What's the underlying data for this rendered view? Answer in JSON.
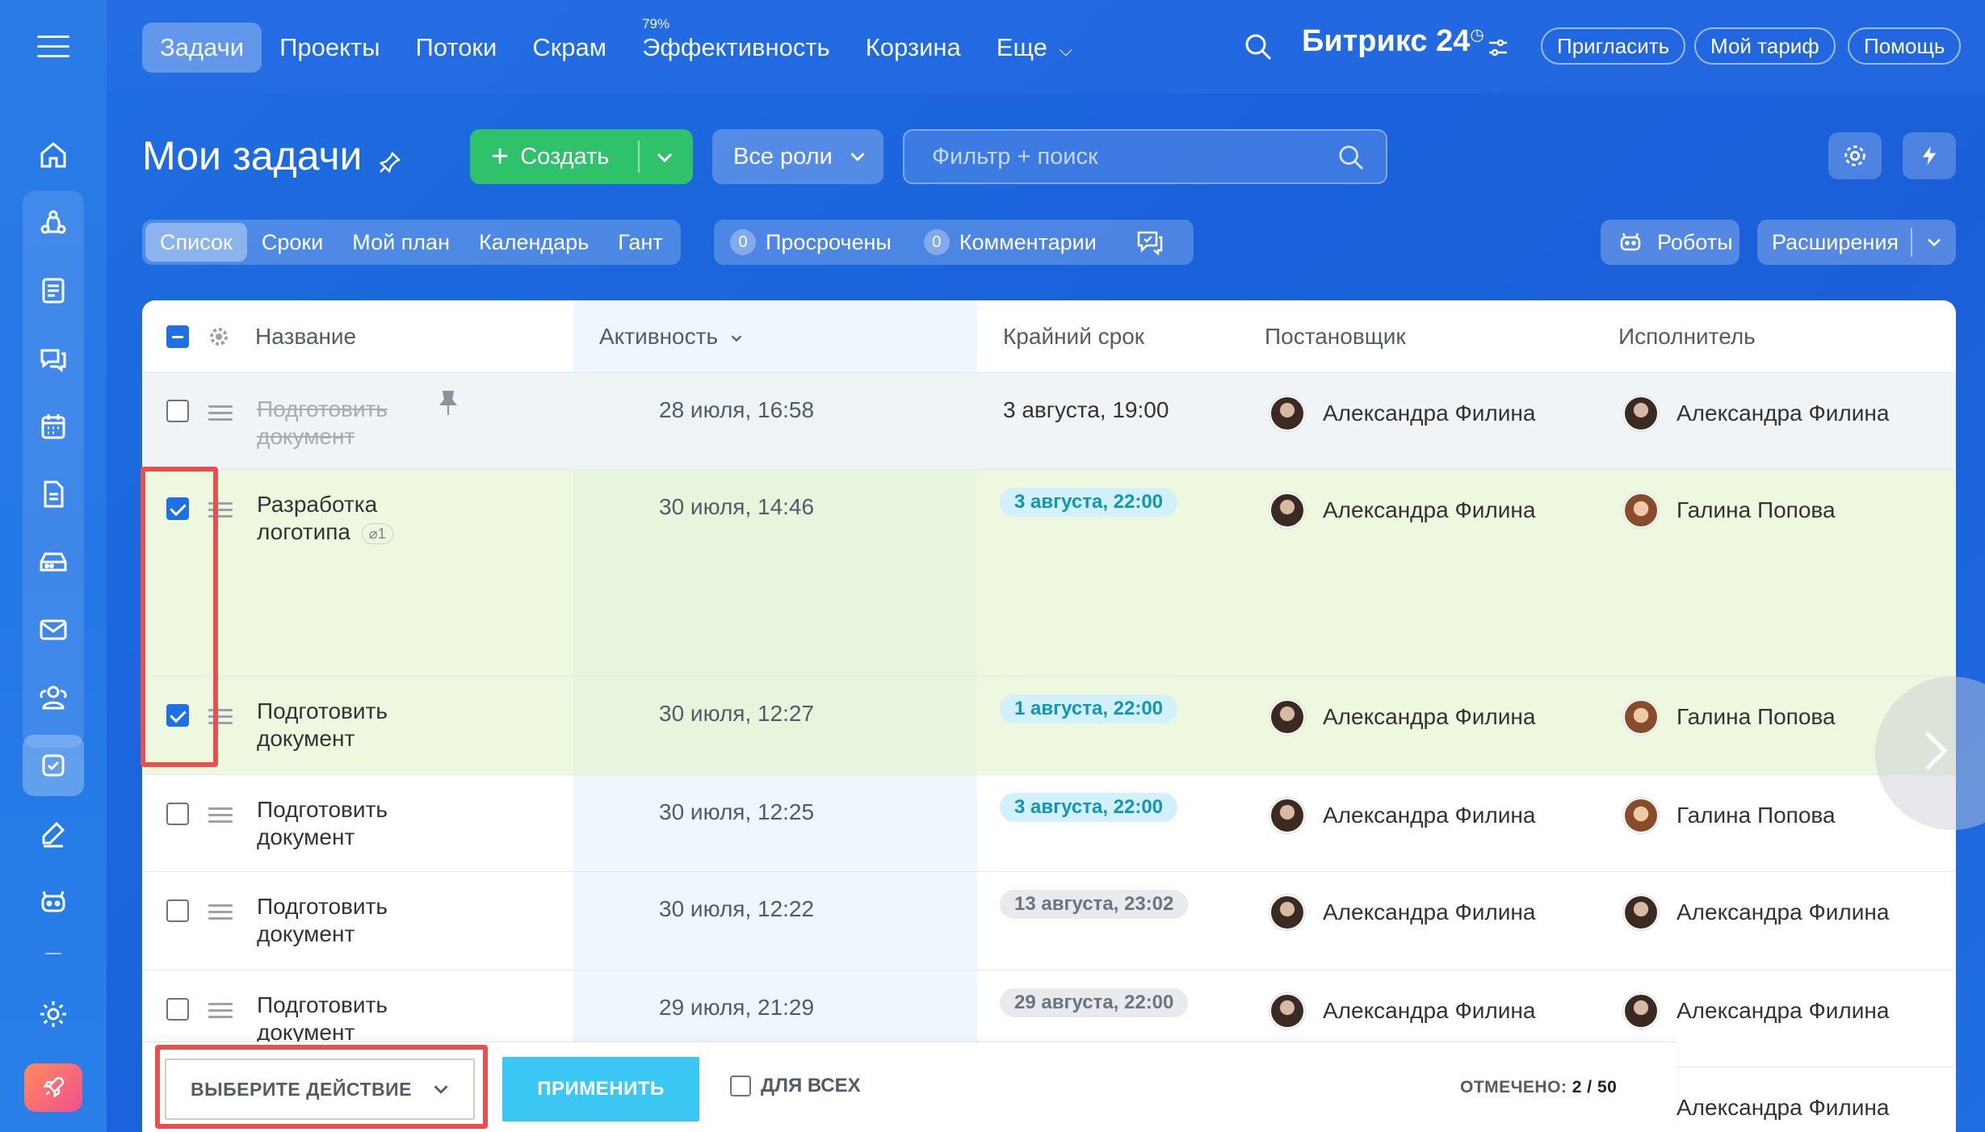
{
  "nav": {
    "items": [
      "Задачи",
      "Проекты",
      "Потоки",
      "Скрам",
      "Эффективность",
      "Корзина",
      "Еще"
    ],
    "efficiency_badge": "79%",
    "more_chevron": "⌵"
  },
  "brand": {
    "name": "Битрикс 24"
  },
  "top_buttons": {
    "invite": "Пригласить",
    "tariff": "Мой тариф",
    "help": "Помощь"
  },
  "header": {
    "title": "Мои задачи",
    "create": "Создать",
    "roles": "Все роли",
    "filter_placeholder": "Фильтр + поиск"
  },
  "views": [
    "Список",
    "Сроки",
    "Мой план",
    "Календарь",
    "Гант"
  ],
  "counters": {
    "overdue_count": "0",
    "overdue_label": "Просрочены",
    "comments_count": "0",
    "comments_label": "Комментарии"
  },
  "right_buttons": {
    "robots": "Роботы",
    "extensions": "Расширения"
  },
  "table": {
    "columns": {
      "name": "Название",
      "activity": "Активность",
      "deadline": "Крайний срок",
      "creator": "Постановщик",
      "assignee": "Исполнитель"
    },
    "rows": [
      {
        "name": "Подготовить документ",
        "activity": "28 июля, 16:58",
        "deadline": "3 августа, 19:00",
        "creator": "Александра Филина",
        "assignee": "Александра Филина"
      },
      {
        "name": "Разработка логотипа",
        "attachments": "1",
        "activity": "30 июля, 14:46",
        "deadline": "3 августа, 22:00",
        "creator": "Александра Филина",
        "assignee": "Галина Попова"
      },
      {
        "name": "Подготовить документ",
        "activity": "30 июля, 12:27",
        "deadline": "1 августа, 22:00",
        "creator": "Александра Филина",
        "assignee": "Галина Попова"
      },
      {
        "name": "Подготовить документ",
        "activity": "30 июля, 12:25",
        "deadline": "3 августа, 22:00",
        "creator": "Александра Филина",
        "assignee": "Галина Попова"
      },
      {
        "name": "Подготовить документ",
        "activity": "30 июля, 12:22",
        "deadline": "13 августа, 23:02",
        "creator": "Александра Филина",
        "assignee": "Александра Филина"
      },
      {
        "name": "Подготовить документ",
        "activity": "29 июля, 21:29",
        "deadline": "29 августа, 22:00",
        "creator": "Александра Филина",
        "assignee": "Александра Филина"
      },
      {
        "assignee": "Александра Филина"
      }
    ]
  },
  "action_bar": {
    "select_action": "ВЫБЕРИТЕ ДЕЙСТВИЕ",
    "apply": "ПРИМЕНИТЬ",
    "for_all": "ДЛЯ ВСЕХ",
    "marked_label": "ОТМЕЧЕНО:",
    "marked_value": "2 / 50"
  },
  "colors": {
    "accent_blue": "#1f6fe5",
    "create_green": "#2fc26b",
    "apply_cyan": "#3bc8f5",
    "highlight_red": "#e8504f",
    "selected_row": "#e1f3c8"
  },
  "icons": {
    "sidebar": [
      "home-icon",
      "flow-icon",
      "feed-icon",
      "chat-icon",
      "calendar-icon",
      "document-icon",
      "storage-icon",
      "mail-icon",
      "contacts-icon",
      "tasks-icon",
      "sign-icon",
      "robot-icon",
      "settings-icon",
      "rocket-icon"
    ]
  }
}
